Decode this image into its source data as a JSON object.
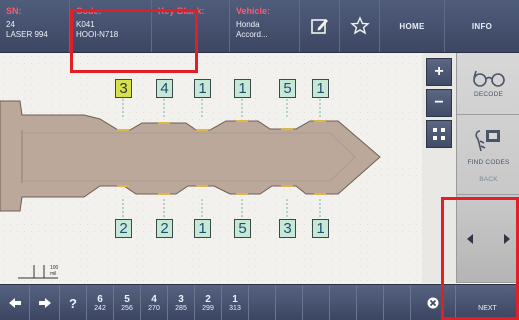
{
  "header": {
    "sn_label": "SN:",
    "sn_value_1": "24",
    "sn_value_2": "LASER 994",
    "code_label": "Code:",
    "code_value_1": "K041",
    "code_value_2": "HOOI-N718",
    "keyblank_label": "Key Blank:",
    "vehicle_label": "Vehicle:",
    "vehicle_value_1": "Honda",
    "vehicle_value_2": "Accord...",
    "home_label": "HOME",
    "info_label": "INFO"
  },
  "key": {
    "top_cuts": [
      "3",
      "4",
      "1",
      "1",
      "5",
      "1"
    ],
    "bottom_cuts": [
      "2",
      "2",
      "1",
      "5",
      "3",
      "1"
    ],
    "selected_index": 0,
    "scale_label_1": "100",
    "scale_label_2": "mil"
  },
  "side": {
    "decode_label": "DECODE",
    "find_codes_label": "FIND CODES",
    "back_label": "BACK"
  },
  "bottom": {
    "help_label": "?",
    "depths": [
      {
        "num": "6",
        "sub": "242"
      },
      {
        "num": "5",
        "sub": "256"
      },
      {
        "num": "4",
        "sub": "270"
      },
      {
        "num": "3",
        "sub": "285"
      },
      {
        "num": "2",
        "sub": "299"
      },
      {
        "num": "1",
        "sub": "313"
      }
    ],
    "next_label": "NEXT"
  },
  "colors": {
    "accent_red": "#e41e26",
    "cut_fill": "#c7e8d7",
    "cut_selected": "#d8e04a",
    "key_body": "#bba89a"
  }
}
